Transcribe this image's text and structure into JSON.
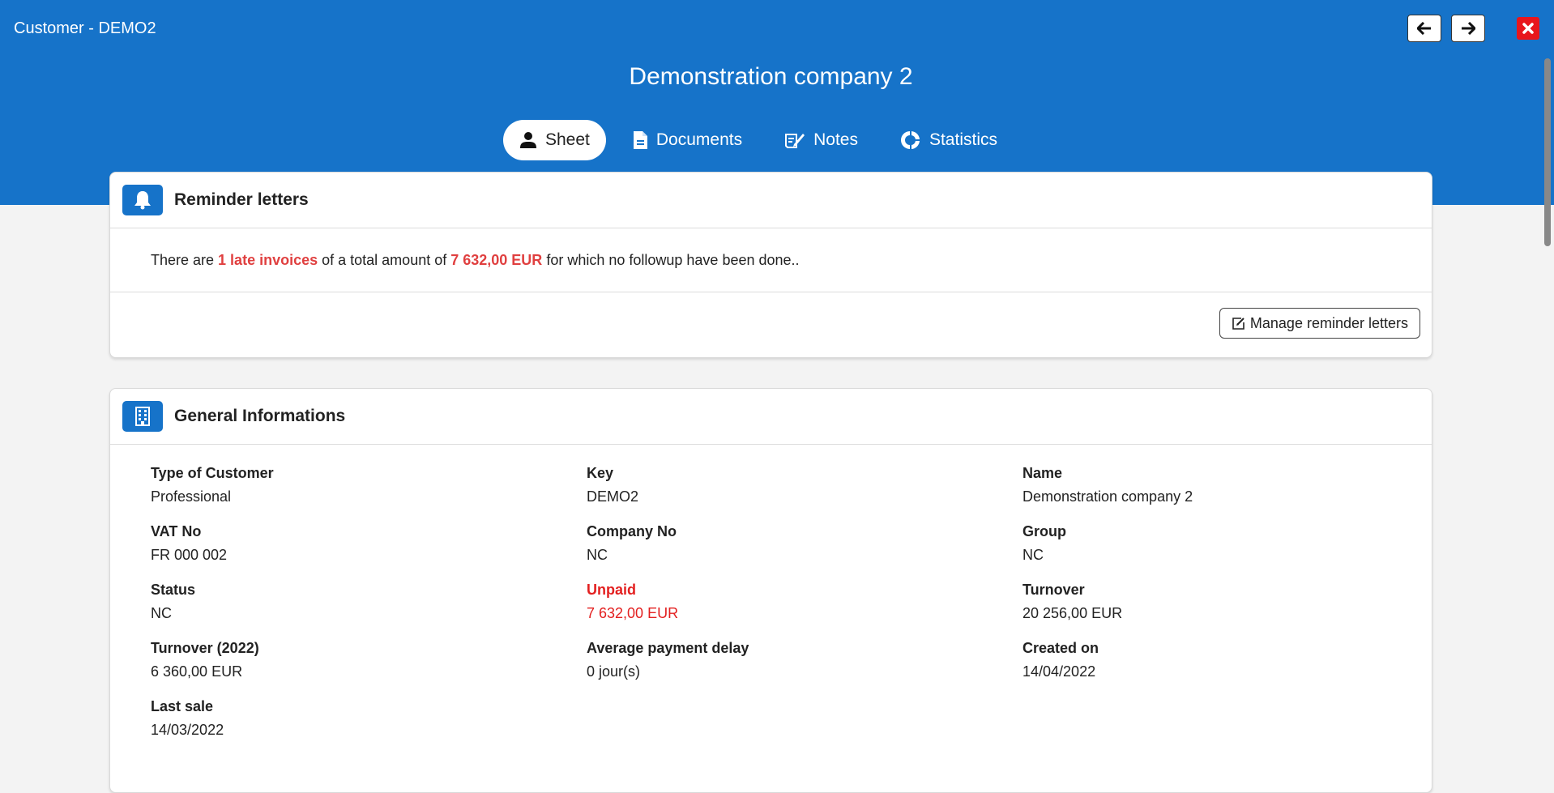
{
  "window": {
    "title": "Customer - DEMO2",
    "prev_icon": "arrow-left-icon",
    "next_icon": "arrow-right-icon",
    "close_icon": "close-icon"
  },
  "colors": {
    "primary": "#1673c9",
    "alert": "#e32020",
    "close": "#e8161c"
  },
  "header": {
    "company_name": "Demonstration company 2"
  },
  "tabs": [
    {
      "label": "Sheet",
      "icon": "person-icon",
      "active": true
    },
    {
      "label": "Documents",
      "icon": "document-icon",
      "active": false
    },
    {
      "label": "Notes",
      "icon": "notes-icon",
      "active": false
    },
    {
      "label": "Statistics",
      "icon": "pie-chart-icon",
      "active": false
    }
  ],
  "reminder": {
    "title": "Reminder letters",
    "icon": "bell-icon",
    "text_1": "There are ",
    "late_count": "1 late invoices",
    "text_2": " of a total amount of ",
    "amount": "7 632,00 EUR",
    "text_3": " for which no followup have been done..",
    "manage_button": "Manage reminder letters",
    "manage_icon": "edit-icon"
  },
  "general": {
    "title": "General Informations",
    "icon": "building-icon",
    "fields": [
      {
        "label": "Type of Customer",
        "value": "Professional"
      },
      {
        "label": "Key",
        "value": "DEMO2"
      },
      {
        "label": "Name",
        "value": "Demonstration company 2"
      },
      {
        "label": "VAT No",
        "value": "FR 000 002"
      },
      {
        "label": "Company No",
        "value": "NC"
      },
      {
        "label": "Group",
        "value": "NC"
      },
      {
        "label": "Status",
        "value": "NC"
      },
      {
        "label": "Unpaid",
        "value": "7 632,00 EUR",
        "highlight": true
      },
      {
        "label": "Turnover",
        "value": "20 256,00 EUR"
      },
      {
        "label": "Turnover (2022)",
        "value": "6 360,00 EUR"
      },
      {
        "label": "Average payment delay",
        "value": "0 jour(s)"
      },
      {
        "label": "Created on",
        "value": "14/04/2022"
      },
      {
        "label": "Last sale",
        "value": "14/03/2022"
      }
    ]
  }
}
